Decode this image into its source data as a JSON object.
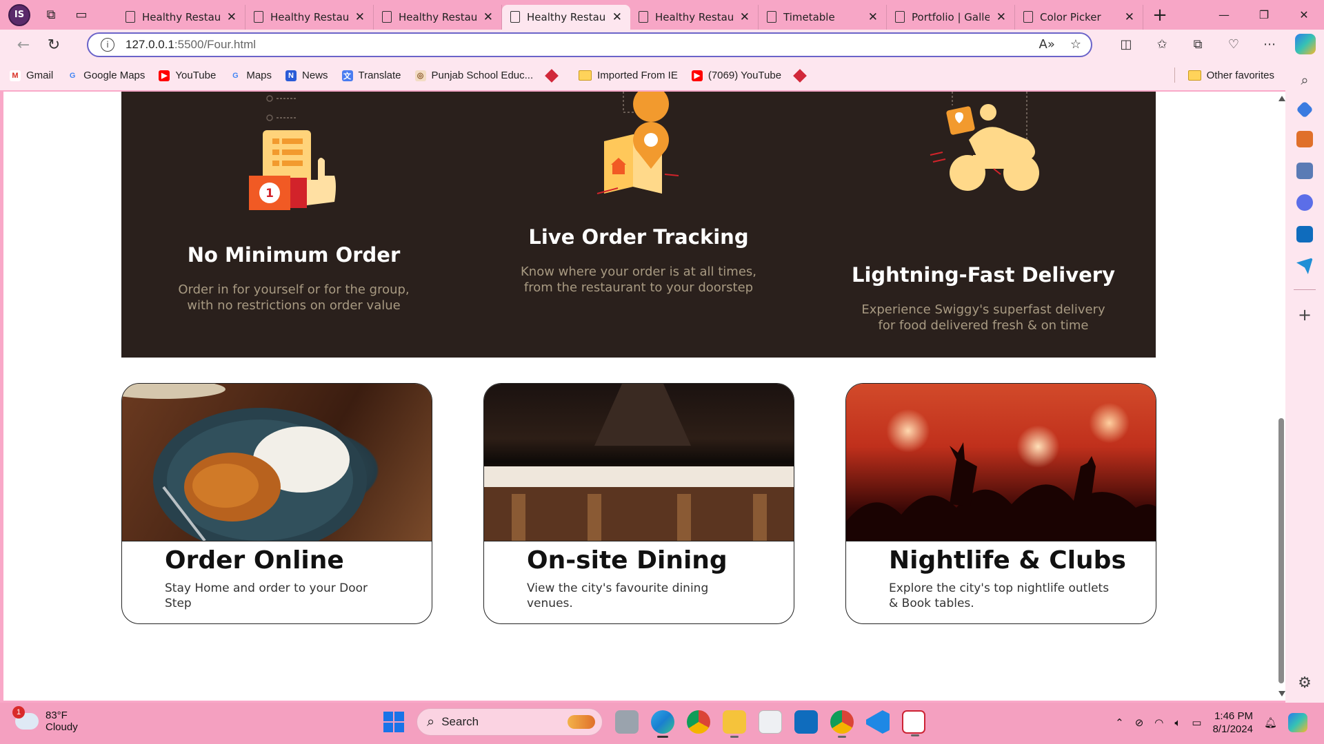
{
  "browser": {
    "profile_initials": "IS",
    "tabs": [
      {
        "title": "Healthy Restaur",
        "active": false
      },
      {
        "title": "Healthy Restaur",
        "active": false
      },
      {
        "title": "Healthy Restaur",
        "active": false
      },
      {
        "title": "Healthy Restaur",
        "active": true
      },
      {
        "title": "Healthy Restaur",
        "active": false
      },
      {
        "title": "Timetable",
        "active": false
      },
      {
        "title": "Portfolio | Galle",
        "active": false
      },
      {
        "title": "Color Picker",
        "active": false
      }
    ],
    "address": {
      "host": "127.0.0.1",
      "path": ":5500/Four.html"
    },
    "favorites": [
      {
        "label": "Gmail",
        "icon": "gmail-icon",
        "color": "#d93025"
      },
      {
        "label": "Google Maps",
        "icon": "google-icon",
        "color": "#4285f4"
      },
      {
        "label": "YouTube",
        "icon": "youtube-icon",
        "color": "#ff0000"
      },
      {
        "label": "Maps",
        "icon": "google-icon",
        "color": "#4285f4"
      },
      {
        "label": "News",
        "icon": "news-icon",
        "color": "#2a5bd7"
      },
      {
        "label": "Translate",
        "icon": "translate-icon",
        "color": "#4a7cf0"
      },
      {
        "label": "Punjab School Educ...",
        "icon": "school-icon",
        "color": "#c98a4a"
      },
      {
        "label": "",
        "icon": "diamond-icon",
        "color": "#d1283a"
      },
      {
        "label": "Imported From IE",
        "icon": "folder-icon",
        "color": "#ffd35a"
      },
      {
        "label": "(7069) YouTube",
        "icon": "youtube-icon",
        "color": "#ff0000"
      },
      {
        "label": "",
        "icon": "diamond-icon",
        "color": "#d1283a"
      }
    ],
    "other_favorites": "Other favorites"
  },
  "page": {
    "features": [
      {
        "title": "No Minimum Order",
        "text": "Order in for yourself or for the group, with no restrictions on order value"
      },
      {
        "title": "Live Order Tracking",
        "text": "Know where your order is at all times, from the restaurant to your doorstep"
      },
      {
        "title": "Lightning-Fast Delivery",
        "text": "Experience Swiggy's superfast delivery for food delivered fresh & on time"
      }
    ],
    "cards": [
      {
        "title": "Order Online",
        "text": "Stay Home and order to your Door Step"
      },
      {
        "title": "On-site Dining",
        "text": "View the city's favourite dining venues."
      },
      {
        "title": "Nightlife & Clubs",
        "text": "Explore the city's top nightlife outlets & Book tables."
      }
    ],
    "feature_band_color": "#2a201c"
  },
  "taskbar": {
    "weather_badge": "1",
    "temperature": "83°F",
    "condition": "Cloudy",
    "search_label": "Search",
    "time": "1:46 PM",
    "date": "8/1/2024"
  }
}
